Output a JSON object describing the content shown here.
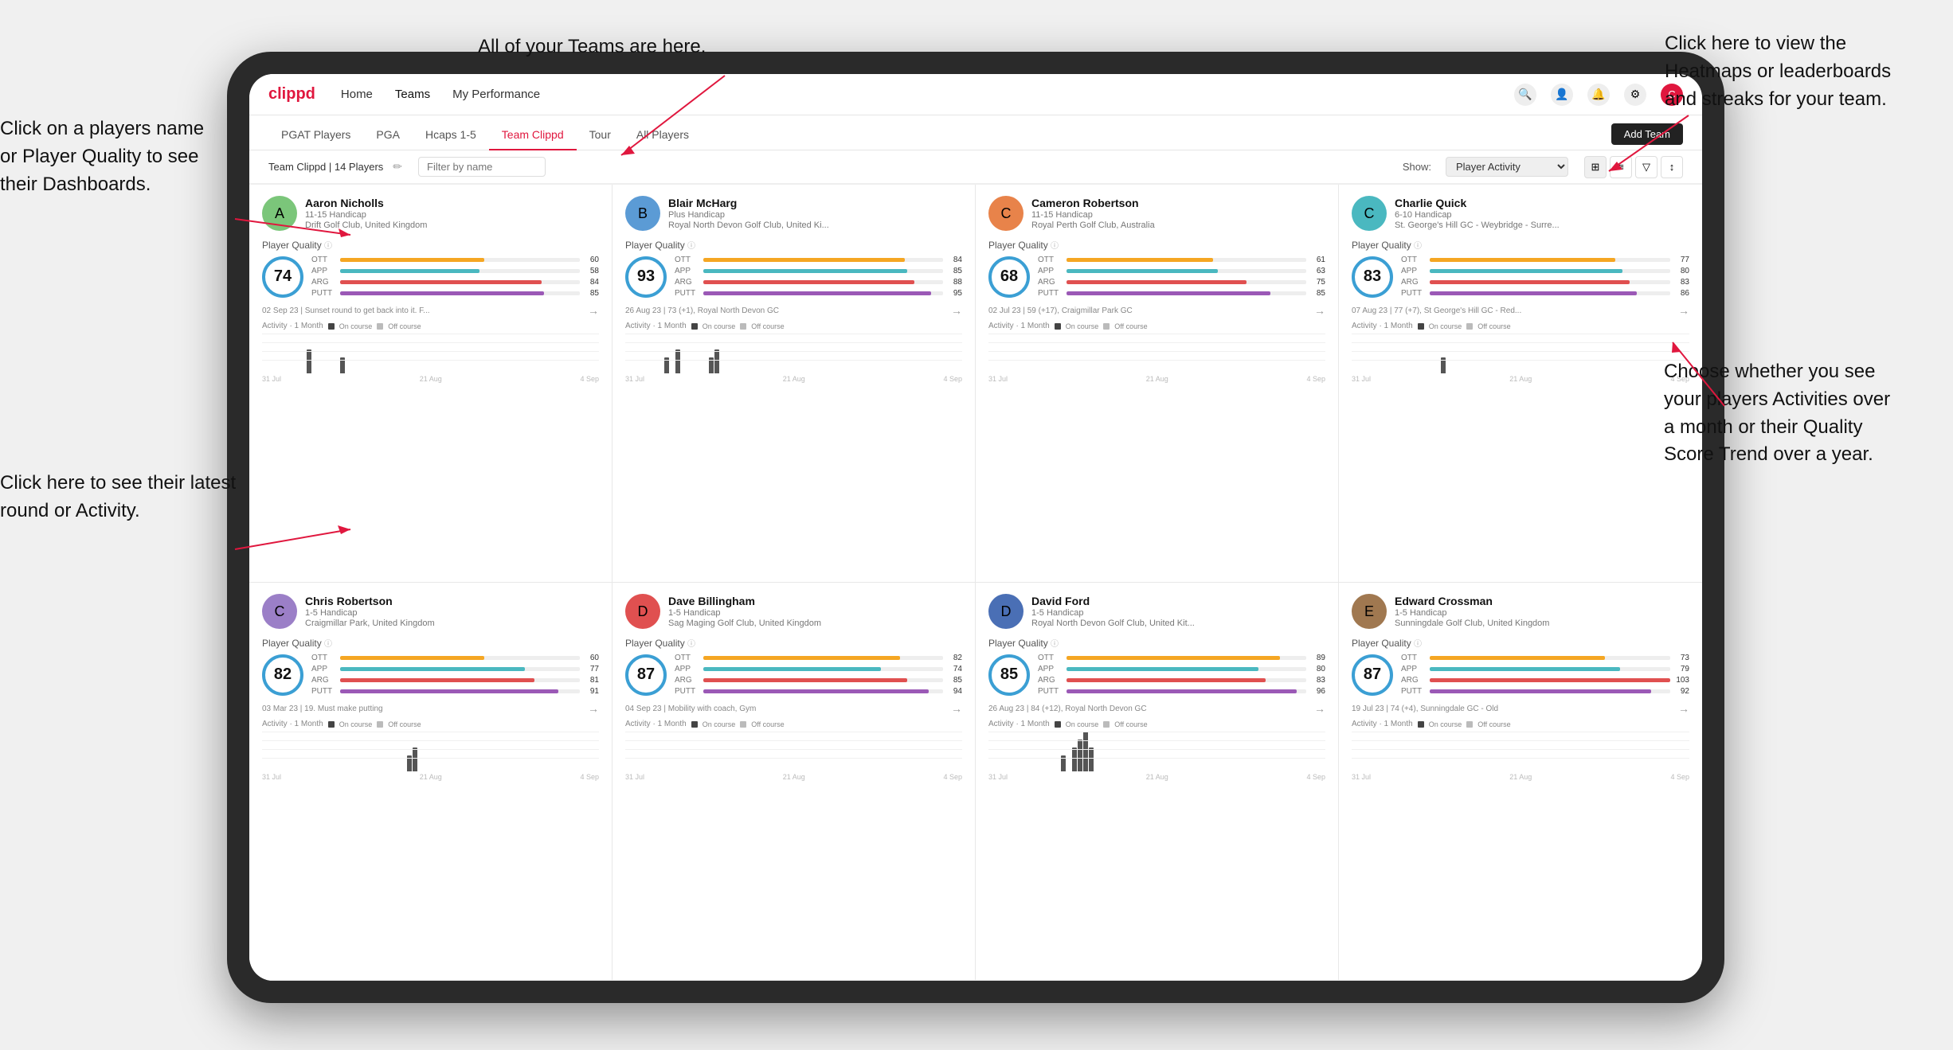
{
  "annotations": {
    "teams_tooltip": "All of your Teams are here.",
    "heatmaps_tooltip": "Click here to view the\nHeatmaps or leaderboards\nand streaks for your team.",
    "players_name_tooltip": "Click on a players name\nor Player Quality to see\ntheir Dashboards.",
    "latest_round_tooltip": "Click here to see their latest\nround or Activity.",
    "activity_tooltip": "Choose whether you see\nyour players Activities over\na month or their Quality\nScore Trend over a year."
  },
  "nav": {
    "logo": "clippd",
    "links": [
      "Home",
      "Teams",
      "My Performance"
    ],
    "add_team": "Add Team"
  },
  "sub_tabs": [
    "PGAT Players",
    "PGA",
    "Hcaps 1-5",
    "Team Clippd",
    "Tour",
    "All Players"
  ],
  "active_sub_tab": "Team Clippd",
  "team_header": {
    "label": "Team Clippd | 14 Players",
    "show_label": "Show:",
    "show_value": "Player Activity",
    "filter_placeholder": "Filter by name"
  },
  "players": [
    {
      "name": "Aaron Nicholls",
      "handicap": "11-15 Handicap",
      "club": "Drift Golf Club, United Kingdom",
      "quality": 74,
      "ott": 60,
      "app": 58,
      "arg": 84,
      "putt": 85,
      "recent": "02 Sep 23 | Sunset round to get back into it. F...",
      "avatar_color": "green",
      "bars": [
        0,
        0,
        0,
        0,
        0,
        0,
        0,
        0,
        3,
        0,
        0,
        0,
        0,
        0,
        2,
        0,
        0,
        0,
        0,
        0,
        0,
        0,
        0,
        0,
        0,
        0,
        0,
        0,
        0,
        0
      ]
    },
    {
      "name": "Blair McHarg",
      "handicap": "Plus Handicap",
      "club": "Royal North Devon Golf Club, United Ki...",
      "quality": 93,
      "ott": 84,
      "app": 85,
      "arg": 88,
      "putt": 95,
      "recent": "26 Aug 23 | 73 (+1), Royal North Devon GC",
      "avatar_color": "blue",
      "bars": [
        0,
        0,
        0,
        0,
        0,
        0,
        0,
        2,
        0,
        3,
        0,
        0,
        0,
        0,
        0,
        2,
        3,
        0,
        0,
        0,
        0,
        0,
        0,
        0,
        0,
        0,
        0,
        0,
        0,
        0
      ]
    },
    {
      "name": "Cameron Robertson",
      "handicap": "11-15 Handicap",
      "club": "Royal Perth Golf Club, Australia",
      "quality": 68,
      "ott": 61,
      "app": 63,
      "arg": 75,
      "putt": 85,
      "recent": "02 Jul 23 | 59 (+17), Craigmillar Park GC",
      "avatar_color": "orange",
      "bars": [
        0,
        0,
        0,
        0,
        0,
        0,
        0,
        0,
        0,
        0,
        0,
        0,
        0,
        0,
        0,
        0,
        0,
        0,
        0,
        0,
        0,
        0,
        0,
        0,
        0,
        0,
        0,
        0,
        0,
        0
      ]
    },
    {
      "name": "Charlie Quick",
      "handicap": "6-10 Handicap",
      "club": "St. George's Hill GC - Weybridge - Surre...",
      "quality": 83,
      "ott": 77,
      "app": 80,
      "arg": 83,
      "putt": 86,
      "recent": "07 Aug 23 | 77 (+7), St George's Hill GC - Red...",
      "avatar_color": "teal",
      "bars": [
        0,
        0,
        0,
        0,
        0,
        0,
        0,
        0,
        0,
        0,
        0,
        0,
        0,
        0,
        0,
        0,
        2,
        0,
        0,
        0,
        0,
        0,
        0,
        0,
        0,
        0,
        0,
        0,
        0,
        0
      ]
    },
    {
      "name": "Chris Robertson",
      "handicap": "1-5 Handicap",
      "club": "Craigmillar Park, United Kingdom",
      "quality": 82,
      "ott": 60,
      "app": 77,
      "arg": 81,
      "putt": 91,
      "recent": "03 Mar 23 | 19. Must make putting",
      "avatar_color": "purple",
      "bars": [
        0,
        0,
        0,
        0,
        0,
        0,
        0,
        0,
        0,
        0,
        0,
        0,
        0,
        0,
        0,
        0,
        0,
        0,
        0,
        0,
        0,
        0,
        0,
        0,
        0,
        0,
        2,
        3,
        0,
        0
      ]
    },
    {
      "name": "Dave Billingham",
      "handicap": "1-5 Handicap",
      "club": "Sag Maging Golf Club, United Kingdom",
      "quality": 87,
      "ott": 82,
      "app": 74,
      "arg": 85,
      "putt": 94,
      "recent": "04 Sep 23 | Mobility with coach, Gym",
      "avatar_color": "red",
      "bars": [
        0,
        0,
        0,
        0,
        0,
        0,
        0,
        0,
        0,
        0,
        0,
        0,
        0,
        0,
        0,
        0,
        0,
        0,
        0,
        0,
        0,
        0,
        0,
        0,
        0,
        0,
        0,
        0,
        0,
        0
      ]
    },
    {
      "name": "David Ford",
      "handicap": "1-5 Handicap",
      "club": "Royal North Devon Golf Club, United Kit...",
      "quality": 85,
      "ott": 89,
      "app": 80,
      "arg": 83,
      "putt": 96,
      "recent": "26 Aug 23 | 84 (+12), Royal North Devon GC",
      "avatar_color": "darkblue",
      "bars": [
        0,
        0,
        0,
        0,
        0,
        0,
        0,
        0,
        0,
        0,
        0,
        0,
        0,
        2,
        0,
        3,
        4,
        5,
        3,
        0,
        0,
        0,
        0,
        0,
        0,
        0,
        0,
        0,
        0,
        0
      ]
    },
    {
      "name": "Edward Crossman",
      "handicap": "1-5 Handicap",
      "club": "Sunningdale Golf Club, United Kingdom",
      "quality": 87,
      "ott": 73,
      "app": 79,
      "arg": 103,
      "putt": 92,
      "recent": "19 Jul 23 | 74 (+4), Sunningdale GC - Old",
      "avatar_color": "brown",
      "bars": [
        0,
        0,
        0,
        0,
        0,
        0,
        0,
        0,
        0,
        0,
        0,
        0,
        0,
        0,
        0,
        0,
        0,
        0,
        0,
        0,
        0,
        0,
        0,
        0,
        0,
        0,
        0,
        0,
        0,
        0
      ]
    }
  ]
}
